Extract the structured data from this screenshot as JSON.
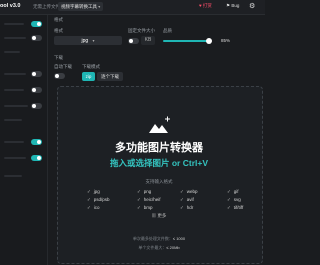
{
  "topbar": {
    "app_title": "ool v3.0",
    "link": "无需上传文件",
    "tool_tab": "视频字幕转换工具",
    "favorite": "♥ 打赏",
    "bug": "Bug",
    "icons": {
      "gear": "gear-icon"
    }
  },
  "settings": {
    "format_section": "格式",
    "mode_label": "格式",
    "format_value": "jpg",
    "keep_size_label": "固定文件大小",
    "keep_size_value": "KB",
    "quality_label": "品质",
    "quality_value": "85%",
    "quality_fraction": 0.85,
    "download_section": "下载",
    "auto_download_label": "自动下载",
    "download_mode_label": "下载模式",
    "zip_label": "zip",
    "single_label": "逐个下载"
  },
  "dropzone": {
    "title": "多功能图片转换器",
    "subtitle": "拖入或选择图片 or Ctrl+V",
    "formats_title": "支持输入格式",
    "formats": [
      [
        "jpg",
        "png",
        "webp",
        "gif"
      ],
      [
        "psd/psb",
        "heic/heif",
        "avif",
        "svg"
      ],
      [
        "ico",
        "bmp",
        "hdr",
        "tif/tiff"
      ]
    ],
    "more": "更多",
    "limit_count": "单次最多处理文件数：",
    "limit_count_value": "≤ 1000",
    "limit_size": "单个文件最大：",
    "limit_size_value": "≤ 20Mb"
  },
  "colors": {
    "accent": "#1fb6b4",
    "heading_accent": "#34c4c0",
    "background": "#1a1c1f"
  }
}
